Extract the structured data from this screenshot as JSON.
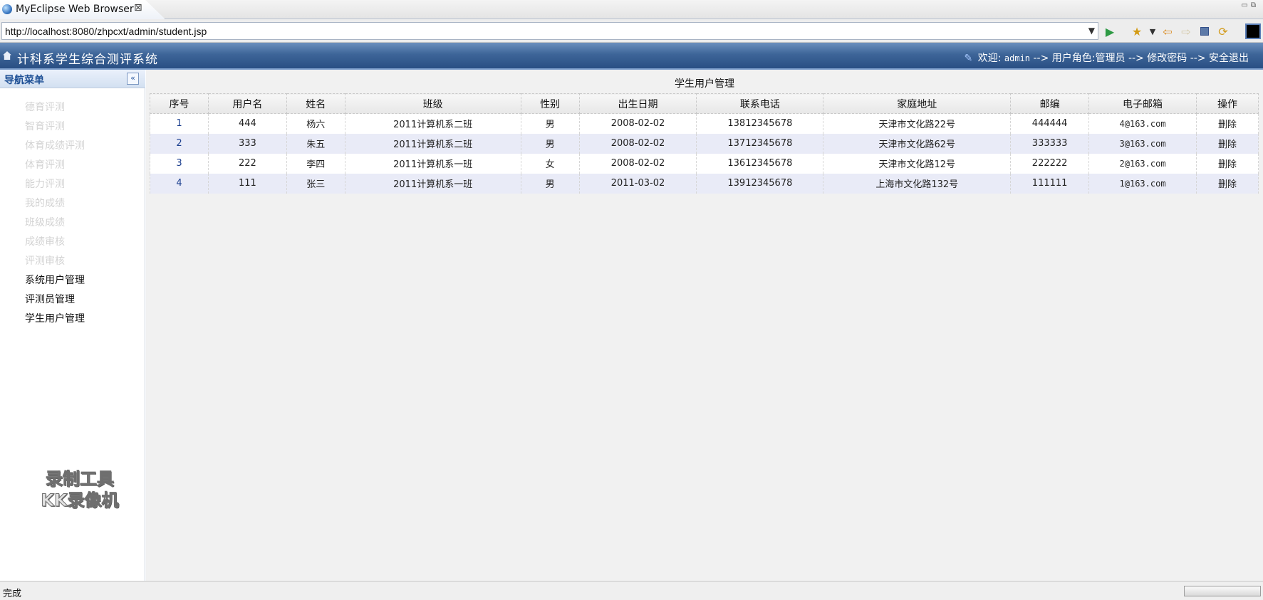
{
  "browser": {
    "tab_title": "MyEclipse Web Browser",
    "url": "http://localhost:8080/zhpcxt/admin/student.jsp",
    "status": "完成"
  },
  "header": {
    "system_title": "计科系学生综合测评系统",
    "welcome_label": "欢迎:",
    "username": "admin",
    "arrow": "-->",
    "role_text": "用户角色:管理员",
    "change_password": "修改密码",
    "logout": "安全退出"
  },
  "sidebar": {
    "title": "导航菜单",
    "collapse_glyph": "«",
    "items": [
      {
        "label": "德育评测",
        "enabled": false
      },
      {
        "label": "智育评测",
        "enabled": false
      },
      {
        "label": "体育成绩评测",
        "enabled": false
      },
      {
        "label": "体育评测",
        "enabled": false
      },
      {
        "label": "能力评测",
        "enabled": false
      },
      {
        "label": "我的成绩",
        "enabled": false
      },
      {
        "label": "班级成绩",
        "enabled": false
      },
      {
        "label": "成绩审核",
        "enabled": false
      },
      {
        "label": "评测审核",
        "enabled": false
      },
      {
        "label": "系统用户管理",
        "enabled": true
      },
      {
        "label": "评测员管理",
        "enabled": true
      },
      {
        "label": "学生用户管理",
        "enabled": true
      }
    ],
    "watermark_line1": "录制工具",
    "watermark_line2": "KK录像机"
  },
  "main": {
    "caption": "学生用户管理",
    "columns": [
      "序号",
      "用户名",
      "姓名",
      "班级",
      "性别",
      "出生日期",
      "联系电话",
      "家庭地址",
      "邮编",
      "电子邮箱",
      "操作"
    ],
    "rows": [
      [
        "1",
        "444",
        "杨六",
        "2011计算机系二班",
        "男",
        "2008-02-02",
        "13812345678",
        "天津市文化路22号",
        "444444",
        "4@163.com",
        "删除"
      ],
      [
        "2",
        "333",
        "朱五",
        "2011计算机系二班",
        "男",
        "2008-02-02",
        "13712345678",
        "天津市文化路62号",
        "333333",
        "3@163.com",
        "删除"
      ],
      [
        "3",
        "222",
        "李四",
        "2011计算机系一班",
        "女",
        "2008-02-02",
        "13612345678",
        "天津市文化路12号",
        "222222",
        "2@163.com",
        "删除"
      ],
      [
        "4",
        "111",
        "张三",
        "2011计算机系一班",
        "男",
        "2011-03-02",
        "13912345678",
        "上海市文化路132号",
        "111111",
        "1@163.com",
        "删除"
      ]
    ]
  },
  "icons": {
    "tab": "globe-icon",
    "go": "play-icon",
    "favorites": "star-icon",
    "back": "back-arrow-icon",
    "forward": "forward-arrow-icon",
    "stop": "stop-icon",
    "refresh": "refresh-icon"
  }
}
